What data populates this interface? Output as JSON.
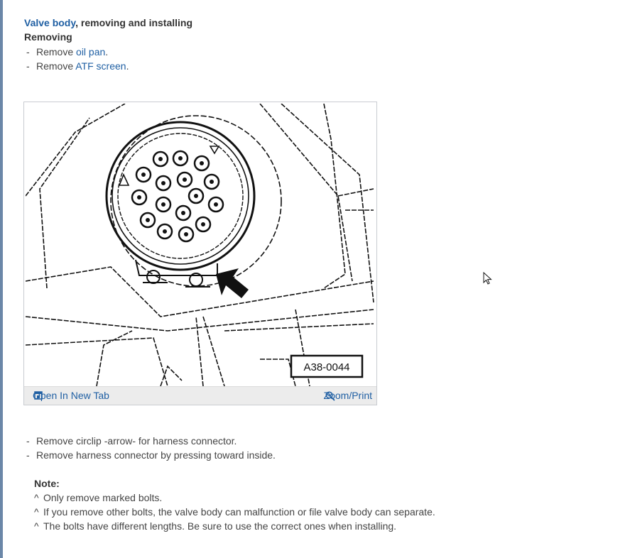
{
  "title": {
    "link": "Valve body",
    "rest": ", removing and installing"
  },
  "section": "Removing",
  "steps_top": [
    {
      "dash": "-",
      "prefix": "Remove ",
      "link": "oil pan",
      "suffix": "."
    },
    {
      "dash": "-",
      "prefix": "Remove ",
      "link": "ATF screen",
      "suffix": "."
    }
  ],
  "figure": {
    "code": "A38-0044",
    "open_tab": "Open In New Tab",
    "zoom": "Zoom/Print"
  },
  "steps_bottom": [
    {
      "dash": "-",
      "text": "Remove circlip -arrow- for harness connector."
    },
    {
      "dash": "-",
      "text": "Remove harness connector by pressing toward inside."
    }
  ],
  "note": {
    "heading": "Note:",
    "items": [
      {
        "caret": "^",
        "text": "Only remove marked bolts."
      },
      {
        "caret": "^",
        "text": "If you remove other bolts, the valve body can malfunction or file valve body can separate."
      },
      {
        "caret": "^",
        "text": "The bolts have different lengths. Be sure to use the correct ones when installing."
      }
    ]
  },
  "colors": {
    "link": "#1f5fa3",
    "left_rule": "#6b87a8"
  }
}
